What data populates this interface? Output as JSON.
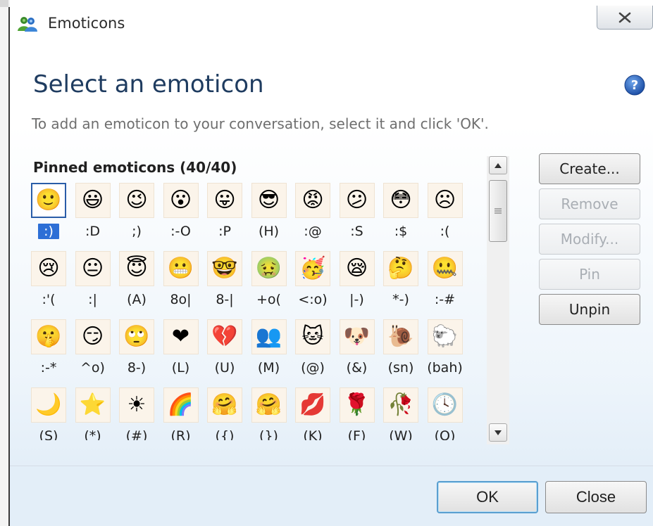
{
  "window": {
    "title": "Emoticons",
    "heading": "Select an emoticon",
    "instruction": "To add an emoticon to your conversation, select it and click 'OK'."
  },
  "icons": {
    "app": "msn-people-icon",
    "close": "close-x-icon",
    "help": "question-mark-icon",
    "scroll_up": "arrow-up-icon",
    "scroll_down": "arrow-down-icon"
  },
  "pinned": {
    "label": "Pinned emoticons (40/40)",
    "selected_index": 0,
    "items": [
      {
        "code": ":)",
        "icon": "smile-icon",
        "glyph": "🙂"
      },
      {
        "code": ":D",
        "icon": "big-grin-icon",
        "glyph": "😃"
      },
      {
        "code": ";)",
        "icon": "wink-icon",
        "glyph": "😉"
      },
      {
        "code": ":-O",
        "icon": "surprised-icon",
        "glyph": "😮"
      },
      {
        "code": ":P",
        "icon": "tongue-out-icon",
        "glyph": "😛"
      },
      {
        "code": "(H)",
        "icon": "hot-sunglasses-icon",
        "glyph": "😎"
      },
      {
        "code": ":@",
        "icon": "angry-icon",
        "glyph": "😡"
      },
      {
        "code": ":S",
        "icon": "confused-icon",
        "glyph": "😕"
      },
      {
        "code": ":$",
        "icon": "embarrassed-icon",
        "glyph": "😳"
      },
      {
        "code": ":(",
        "icon": "sad-icon",
        "glyph": "☹"
      },
      {
        "code": ":'(",
        "icon": "crying-icon",
        "glyph": "😢"
      },
      {
        "code": ":|",
        "icon": "disappointed-icon",
        "glyph": "😐"
      },
      {
        "code": "(A)",
        "icon": "angel-icon",
        "glyph": "😇"
      },
      {
        "code": "8o|",
        "icon": "baring-teeth-icon",
        "glyph": "😬"
      },
      {
        "code": "8-|",
        "icon": "nerd-icon",
        "glyph": "🤓"
      },
      {
        "code": "+o(",
        "icon": "sick-icon",
        "glyph": "🤢"
      },
      {
        "code": "<:o)",
        "icon": "party-icon",
        "glyph": "🥳"
      },
      {
        "code": "|-)",
        "icon": "sleepy-icon",
        "glyph": "😪"
      },
      {
        "code": "*-)",
        "icon": "thinking-icon",
        "glyph": "🤔"
      },
      {
        "code": ":-#",
        "icon": "dont-tell-icon",
        "glyph": "🤐"
      },
      {
        "code": ":-*",
        "icon": "secret-telling-icon",
        "glyph": "🤫"
      },
      {
        "code": "^o)",
        "icon": "sarcastic-icon",
        "glyph": "😏"
      },
      {
        "code": "8-)",
        "icon": "eye-rolling-icon",
        "glyph": "🙄"
      },
      {
        "code": "(L)",
        "icon": "red-heart-icon",
        "glyph": "❤"
      },
      {
        "code": "(U)",
        "icon": "broken-heart-icon",
        "glyph": "💔"
      },
      {
        "code": "(M)",
        "icon": "messenger-icon",
        "glyph": "👥"
      },
      {
        "code": "(@)",
        "icon": "cat-face-icon",
        "glyph": "🐱"
      },
      {
        "code": "(&)",
        "icon": "dog-face-icon",
        "glyph": "🐶"
      },
      {
        "code": "(sn)",
        "icon": "snail-icon",
        "glyph": "🐌"
      },
      {
        "code": "(bah)",
        "icon": "black-sheep-icon",
        "glyph": "🐑"
      },
      {
        "code": "(S)",
        "icon": "moon-icon",
        "glyph": "🌙"
      },
      {
        "code": "(*)",
        "icon": "star-icon",
        "glyph": "⭐"
      },
      {
        "code": "(#)",
        "icon": "sun-icon",
        "glyph": "☀"
      },
      {
        "code": "(R)",
        "icon": "rainbow-icon",
        "glyph": "🌈"
      },
      {
        "code": "({)",
        "icon": "left-hug-icon",
        "glyph": "🤗"
      },
      {
        "code": "(})",
        "icon": "right-hug-icon",
        "glyph": "🤗"
      },
      {
        "code": "(K)",
        "icon": "red-lips-icon",
        "glyph": "💋"
      },
      {
        "code": "(F)",
        "icon": "red-rose-icon",
        "glyph": "🌹"
      },
      {
        "code": "(W)",
        "icon": "wilted-rose-icon",
        "glyph": "🥀"
      },
      {
        "code": "(O)",
        "icon": "clock-icon",
        "glyph": "🕓"
      }
    ]
  },
  "side_buttons": [
    {
      "label": "Create...",
      "enabled": true
    },
    {
      "label": "Remove",
      "enabled": false
    },
    {
      "label": "Modify...",
      "enabled": false
    },
    {
      "label": "Pin",
      "enabled": false
    },
    {
      "label": "Unpin",
      "enabled": true
    }
  ],
  "footer": {
    "ok_label": "OK",
    "close_label": "Close"
  },
  "colors": {
    "heading": "#1f3c60",
    "selection": "#2d6fd6",
    "help": "#2460b8"
  }
}
